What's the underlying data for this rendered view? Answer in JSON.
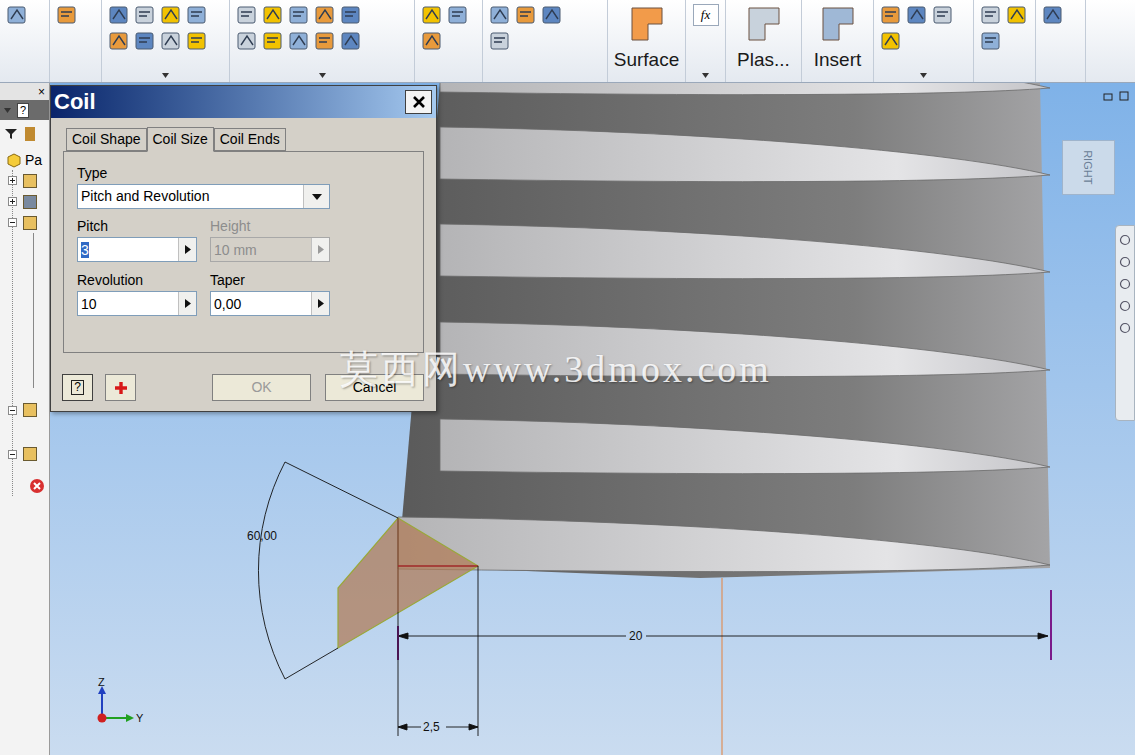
{
  "ribbon": {
    "large_buttons": [
      {
        "label": "Surface"
      },
      {
        "label": "Plas..."
      },
      {
        "label": "Insert"
      }
    ],
    "fx": "fx"
  },
  "browser": {
    "help": "?",
    "close": "×",
    "root_item": "Pa",
    "nodes": [
      {
        "expanded": false
      },
      {
        "expanded": false
      },
      {
        "expanded": true
      },
      {
        "expanded": true
      },
      {
        "expanded": true
      }
    ]
  },
  "dialog": {
    "title": "Coil",
    "tabs": [
      {
        "label": "Coil Shape",
        "selected": false
      },
      {
        "label": "Coil Size",
        "selected": true
      },
      {
        "label": "Coil Ends",
        "selected": false
      }
    ],
    "type": {
      "label": "Type",
      "value": "Pitch and Revolution"
    },
    "fields": [
      {
        "label": "Pitch",
        "value": "3",
        "disabled": false,
        "selected": true
      },
      {
        "label": "Height",
        "value": "10 mm",
        "disabled": true,
        "selected": false
      },
      {
        "label": "Revolution",
        "value": "10",
        "disabled": false,
        "selected": false
      },
      {
        "label": "Taper",
        "value": "0,00",
        "disabled": false,
        "selected": false
      }
    ],
    "help": "?",
    "buttons": [
      {
        "label": "OK",
        "disabled": true
      },
      {
        "label": "Cancel",
        "disabled": false
      }
    ]
  },
  "viewport": {
    "viewcube": "RIGHT",
    "dimensions": [
      {
        "value": "60,00"
      },
      {
        "value": "20"
      },
      {
        "value": "2,5"
      }
    ],
    "axes": [
      "Z",
      "Y"
    ],
    "watermark": "莫西网www.3dmox.com"
  }
}
